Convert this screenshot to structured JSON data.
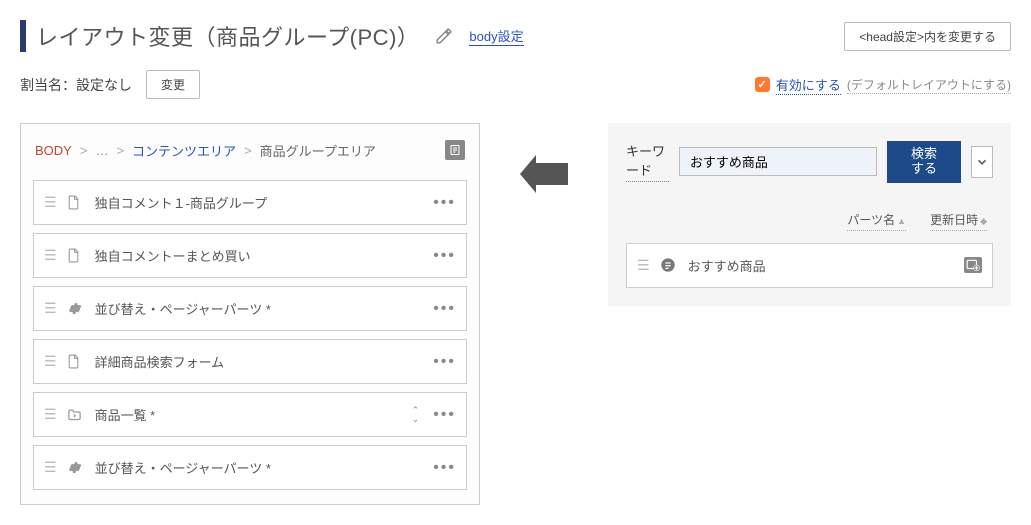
{
  "header": {
    "title": "レイアウト変更（商品グループ(PC)）",
    "body_setting_link": "body設定",
    "head_button": "<head設定>内を変更する"
  },
  "assign": {
    "label": "割当名：設定なし",
    "change_button": "変更",
    "enable_label": "有効にする",
    "default_hint": "(デフォルトレイアウトにする)"
  },
  "breadcrumb": {
    "body": "BODY",
    "sep": ">",
    "ellipsis": "…",
    "content_area": "コンテンツエリア",
    "current": "商品グループエリア"
  },
  "parts": [
    {
      "icon": "page",
      "label": "独自コメント１-商品グループ",
      "arrows": false
    },
    {
      "icon": "page",
      "label": "独自コメントーまとめ買い",
      "arrows": false
    },
    {
      "icon": "gear",
      "label": "並び替え・ページャーパーツ *",
      "arrows": false
    },
    {
      "icon": "page",
      "label": "詳細商品検索フォーム",
      "arrows": false
    },
    {
      "icon": "folder",
      "label": "商品一覧 *",
      "arrows": true
    },
    {
      "icon": "gear",
      "label": "並び替え・ページャーパーツ *",
      "arrows": false
    }
  ],
  "search": {
    "keyword_label": "キーワード",
    "value": "おすすめ商品",
    "button": "検索する"
  },
  "sort": {
    "col1": "パーツ名",
    "col2": "更新日時"
  },
  "results": [
    {
      "label": "おすすめ商品"
    }
  ]
}
